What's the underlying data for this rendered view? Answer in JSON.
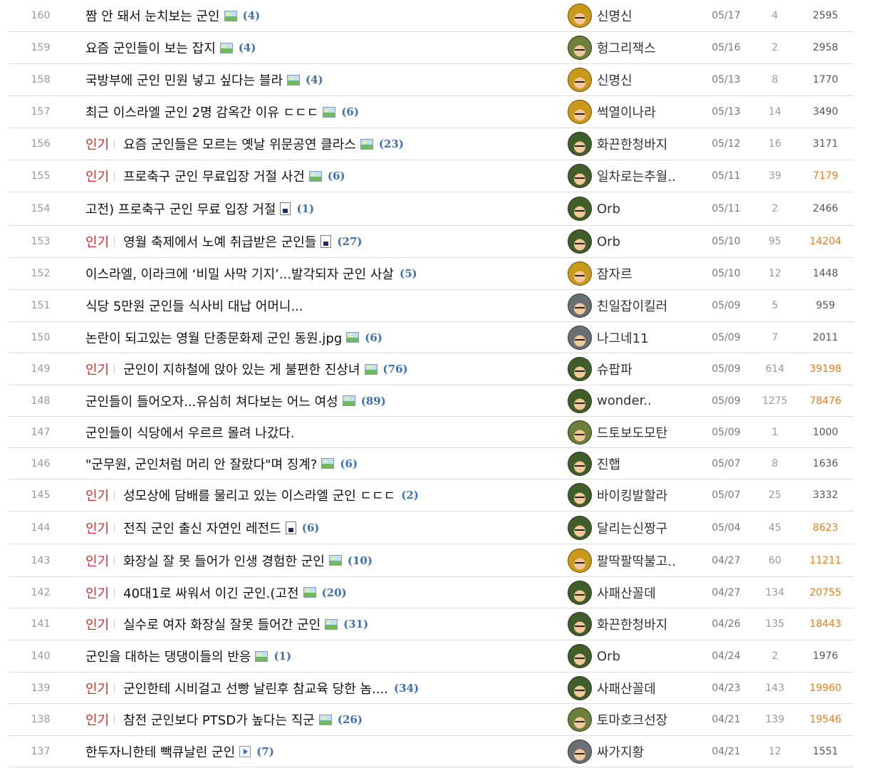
{
  "board": {
    "popular_label": "인기",
    "rows": [
      {
        "num": "160",
        "popular": false,
        "title": "짬 안 돼서 눈치보는 군인",
        "icon": "image-icon",
        "comments": "(4)",
        "author": "신명신",
        "avatar": "gold",
        "date": "05/17",
        "votes": "4",
        "views": "2595",
        "views_hot": false
      },
      {
        "num": "159",
        "popular": false,
        "title": "요즘 군인들이 보는 잡지",
        "icon": "image-icon",
        "comments": "(4)",
        "author": "헝그리잭스",
        "avatar": "olive",
        "date": "05/16",
        "votes": "2",
        "views": "2958",
        "views_hot": false
      },
      {
        "num": "158",
        "popular": false,
        "title": "국방부에 군인 민원 넣고 싶다는 블라",
        "icon": "image-icon",
        "comments": "(4)",
        "author": "신명신",
        "avatar": "gold",
        "date": "05/13",
        "votes": "8",
        "views": "1770",
        "views_hot": false
      },
      {
        "num": "157",
        "popular": false,
        "title": "최근 이스라엘 군인 2명 감옥간 이유 ㄷㄷㄷ",
        "icon": "image-icon",
        "comments": "(6)",
        "author": "썩열이나라",
        "avatar": "gold",
        "date": "05/13",
        "votes": "14",
        "views": "3490",
        "views_hot": false
      },
      {
        "num": "156",
        "popular": true,
        "title": "요즘 군인들은 모르는 옛날 위문공연 클라스",
        "icon": "image-icon",
        "comments": "(23)",
        "author": "화끈한청바지",
        "avatar": "green",
        "date": "05/12",
        "votes": "16",
        "views": "3171",
        "views_hot": false
      },
      {
        "num": "155",
        "popular": true,
        "title": "프로축구 군인 무료입장 거절 사건",
        "icon": "image-icon",
        "comments": "(6)",
        "author": "일차로는추월..",
        "avatar": "green",
        "date": "05/11",
        "votes": "39",
        "views": "7179",
        "views_hot": true
      },
      {
        "num": "154",
        "popular": false,
        "title": "고전) 프로축구 군인 무료 입장 거절",
        "icon": "file-icon",
        "comments": "(1)",
        "author": "Orb",
        "avatar": "green",
        "date": "05/11",
        "votes": "2",
        "views": "2466",
        "views_hot": false
      },
      {
        "num": "153",
        "popular": true,
        "title": "영월 축제에서 노예 취급받은 군인들",
        "icon": "file-icon",
        "comments": "(27)",
        "author": "Orb",
        "avatar": "green",
        "date": "05/10",
        "votes": "95",
        "views": "14204",
        "views_hot": true
      },
      {
        "num": "152",
        "popular": false,
        "title": "이스라엘, 이라크에 ‘비밀 사막 기지’...발각되자 군인 사살",
        "icon": "",
        "comments": "(5)",
        "author": "잠자르",
        "avatar": "gold",
        "date": "05/10",
        "votes": "12",
        "views": "1448",
        "views_hot": false
      },
      {
        "num": "151",
        "popular": false,
        "title": "식당 5만원 군인들 식사비 대납 어머니...",
        "icon": "",
        "comments": "",
        "author": "친일잡이킬러",
        "avatar": "gray",
        "date": "05/09",
        "votes": "5",
        "views": "959",
        "views_hot": false
      },
      {
        "num": "150",
        "popular": false,
        "title": "논란이 되고있는 영월 단종문화제 군인 동원.jpg",
        "icon": "image-icon",
        "comments": "(6)",
        "author": "나그네11",
        "avatar": "gray",
        "date": "05/09",
        "votes": "7",
        "views": "2011",
        "views_hot": false
      },
      {
        "num": "149",
        "popular": true,
        "title": "군인이 지하철에 앉아 있는 게 불편한 진상녀",
        "icon": "image-icon",
        "comments": "(76)",
        "author": "슈팝파",
        "avatar": "green",
        "date": "05/09",
        "votes": "614",
        "views": "39198",
        "views_hot": true
      },
      {
        "num": "148",
        "popular": false,
        "title": "군인들이 들어오자...유심히 쳐다보는 어느 여성",
        "icon": "image-icon",
        "comments": "(89)",
        "author": "wonder..",
        "avatar": "green",
        "date": "05/09",
        "votes": "1275",
        "views": "78476",
        "views_hot": true
      },
      {
        "num": "147",
        "popular": false,
        "title": "군인들이 식당에서 우르르 몰려 나갔다.",
        "icon": "",
        "comments": "",
        "author": "드토보도모탄",
        "avatar": "olive",
        "date": "05/09",
        "votes": "1",
        "views": "1000",
        "views_hot": false
      },
      {
        "num": "146",
        "popular": false,
        "title": "\"군무원, 군인처럼 머리 안 잘랐다\"며 징계?",
        "icon": "image-icon",
        "comments": "(6)",
        "author": "진햅",
        "avatar": "green",
        "date": "05/07",
        "votes": "8",
        "views": "1636",
        "views_hot": false
      },
      {
        "num": "145",
        "popular": true,
        "title": "성모상에 담배를 물리고 있는 이스라엘 군인 ㄷㄷㄷ",
        "icon": "",
        "comments": "(2)",
        "author": "바이킹발할라",
        "avatar": "green",
        "date": "05/07",
        "votes": "25",
        "views": "3332",
        "views_hot": false
      },
      {
        "num": "144",
        "popular": true,
        "title": "전직 군인 출신 자연인 레전드",
        "icon": "file-icon",
        "comments": "(6)",
        "author": "달리는신짱구",
        "avatar": "green",
        "date": "05/04",
        "votes": "45",
        "views": "8623",
        "views_hot": true
      },
      {
        "num": "143",
        "popular": true,
        "title": "화장실 잘 못 들어가 인생 경험한 군인",
        "icon": "image-icon",
        "comments": "(10)",
        "author": "팔딱팔딱불고..",
        "avatar": "gold",
        "date": "04/27",
        "votes": "60",
        "views": "11211",
        "views_hot": true
      },
      {
        "num": "142",
        "popular": true,
        "title": "40대1로 싸워서 이긴 군인.(고전",
        "icon": "image-icon",
        "comments": "(20)",
        "author": "사패산꼴데",
        "avatar": "green",
        "date": "04/27",
        "votes": "134",
        "views": "20755",
        "views_hot": true
      },
      {
        "num": "141",
        "popular": true,
        "title": "실수로 여자 화장실 잘못 들어간 군인",
        "icon": "image-icon",
        "comments": "(31)",
        "author": "화끈한청바지",
        "avatar": "green",
        "date": "04/26",
        "votes": "135",
        "views": "18443",
        "views_hot": true
      },
      {
        "num": "140",
        "popular": false,
        "title": "군인을 대하는 댕댕이들의 반응",
        "icon": "image-icon",
        "comments": "(1)",
        "author": "Orb",
        "avatar": "green",
        "date": "04/24",
        "votes": "2",
        "views": "1976",
        "views_hot": false
      },
      {
        "num": "139",
        "popular": true,
        "title": "군인한테 시비걸고 선빵 날린후 참교육 당한 놈....",
        "icon": "",
        "comments": "(34)",
        "author": "사패산꼴데",
        "avatar": "green",
        "date": "04/23",
        "votes": "143",
        "views": "19960",
        "views_hot": true
      },
      {
        "num": "138",
        "popular": true,
        "title": "참전 군인보다 PTSD가 높다는 직군",
        "icon": "image-icon",
        "comments": "(26)",
        "author": "토마호크선장",
        "avatar": "olive",
        "date": "04/21",
        "votes": "139",
        "views": "19546",
        "views_hot": true
      },
      {
        "num": "137",
        "popular": false,
        "title": "한두자니한테 빽큐날린 군인",
        "icon": "video-icon",
        "comments": "(7)",
        "author": "싸가지황",
        "avatar": "gray",
        "date": "04/21",
        "votes": "12",
        "views": "1551",
        "views_hot": false
      }
    ]
  }
}
